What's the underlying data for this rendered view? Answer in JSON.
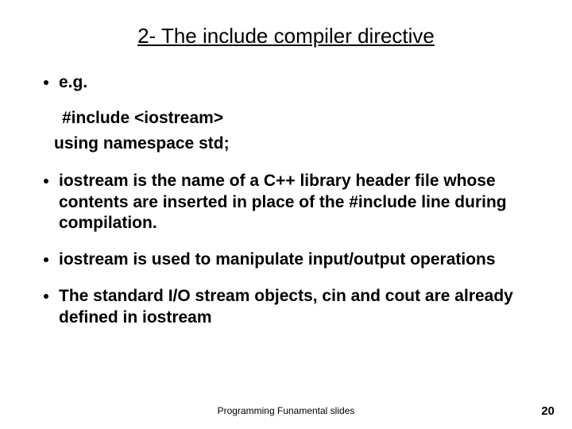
{
  "title": "2- The include compiler directive",
  "bullets": {
    "eg": "e.g.",
    "code1": "#include <iostream>",
    "code2": "using namespace std;",
    "b1": "iostream  is the name of a C++ library header file whose contents are inserted in place of the #include line during compilation.",
    "b2": "iostream is used to manipulate input/output operations",
    "b3": "The standard I/O stream objects, cin and cout are already defined in iostream"
  },
  "footer": {
    "center": "Programming Funamental slides",
    "page": "20"
  }
}
